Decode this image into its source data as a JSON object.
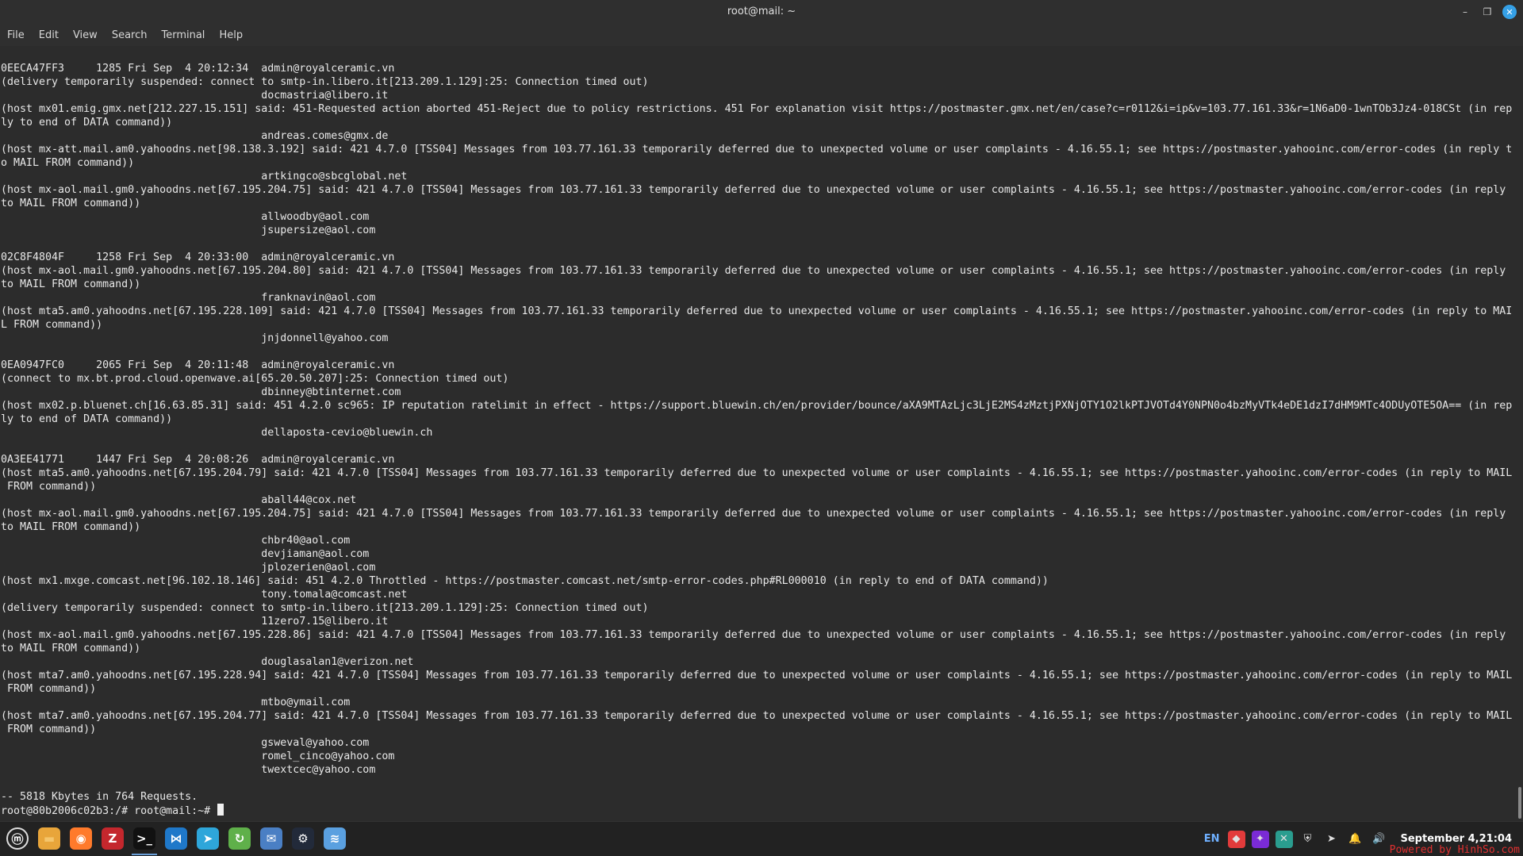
{
  "window": {
    "title": "root@mail: ~",
    "controls": {
      "minimize": "–",
      "maximize": "❐",
      "close": "✕"
    }
  },
  "menu": {
    "items": [
      "File",
      "Edit",
      "View",
      "Search",
      "Terminal",
      "Help"
    ]
  },
  "terminal": {
    "lines": [
      "0EECA47FF3     1285 Fri Sep  4 20:12:34  admin@royalceramic.vn",
      "(delivery temporarily suspended: connect to smtp-in.libero.it[213.209.1.129]:25: Connection timed out)",
      "                                         docmastria@libero.it",
      "(host mx01.emig.gmx.net[212.227.15.151] said: 451-Requested action aborted 451-Reject due to policy restrictions. 451 For explanation visit https://postmaster.gmx.net/en/case?c=r0112&i=ip&v=103.77.161.33&r=1N6aD0-1wnTOb3Jz4-018CSt (in rep",
      "ly to end of DATA command))",
      "                                         andreas.comes@gmx.de",
      "(host mx-att.mail.am0.yahoodns.net[98.138.3.192] said: 421 4.7.0 [TSS04] Messages from 103.77.161.33 temporarily deferred due to unexpected volume or user complaints - 4.16.55.1; see https://postmaster.yahooinc.com/error-codes (in reply t",
      "o MAIL FROM command))",
      "                                         artkingco@sbcglobal.net",
      "(host mx-aol.mail.gm0.yahoodns.net[67.195.204.75] said: 421 4.7.0 [TSS04] Messages from 103.77.161.33 temporarily deferred due to unexpected volume or user complaints - 4.16.55.1; see https://postmaster.yahooinc.com/error-codes (in reply",
      "to MAIL FROM command))",
      "                                         allwoodby@aol.com",
      "                                         jsupersize@aol.com",
      "",
      "02C8F4804F     1258 Fri Sep  4 20:33:00  admin@royalceramic.vn",
      "(host mx-aol.mail.gm0.yahoodns.net[67.195.204.80] said: 421 4.7.0 [TSS04] Messages from 103.77.161.33 temporarily deferred due to unexpected volume or user complaints - 4.16.55.1; see https://postmaster.yahooinc.com/error-codes (in reply",
      "to MAIL FROM command))",
      "                                         franknavin@aol.com",
      "(host mta5.am0.yahoodns.net[67.195.228.109] said: 421 4.7.0 [TSS04] Messages from 103.77.161.33 temporarily deferred due to unexpected volume or user complaints - 4.16.55.1; see https://postmaster.yahooinc.com/error-codes (in reply to MAI",
      "L FROM command))",
      "                                         jnjdonnell@yahoo.com",
      "",
      "0EA0947FC0     2065 Fri Sep  4 20:11:48  admin@royalceramic.vn",
      "(connect to mx.bt.prod.cloud.openwave.ai[65.20.50.207]:25: Connection timed out)",
      "                                         dbinney@btinternet.com",
      "(host mx02.p.bluenet.ch[16.63.85.31] said: 451 4.2.0 sc965: IP reputation ratelimit in effect - https://support.bluewin.ch/en/provider/bounce/aXA9MTAzLjc3LjE2MS4zMztjPXNjOTY1O2lkPTJVOTd4Y0NPN0o4bzMyVTk4eDE1dzI7dHM9MTc4ODUyOTE5OA== (in rep",
      "ly to end of DATA command))",
      "                                         dellaposta-cevio@bluewin.ch",
      "",
      "0A3EE41771     1447 Fri Sep  4 20:08:26  admin@royalceramic.vn",
      "(host mta5.am0.yahoodns.net[67.195.204.79] said: 421 4.7.0 [TSS04] Messages from 103.77.161.33 temporarily deferred due to unexpected volume or user complaints - 4.16.55.1; see https://postmaster.yahooinc.com/error-codes (in reply to MAIL",
      " FROM command))",
      "                                         aball44@cox.net",
      "(host mx-aol.mail.gm0.yahoodns.net[67.195.204.75] said: 421 4.7.0 [TSS04] Messages from 103.77.161.33 temporarily deferred due to unexpected volume or user complaints - 4.16.55.1; see https://postmaster.yahooinc.com/error-codes (in reply",
      "to MAIL FROM command))",
      "                                         chbr40@aol.com",
      "                                         devjiaman@aol.com",
      "                                         jplozerien@aol.com",
      "(host mx1.mxge.comcast.net[96.102.18.146] said: 451 4.2.0 Throttled - https://postmaster.comcast.net/smtp-error-codes.php#RL000010 (in reply to end of DATA command))",
      "                                         tony.tomala@comcast.net",
      "(delivery temporarily suspended: connect to smtp-in.libero.it[213.209.1.129]:25: Connection timed out)",
      "                                         11zero7.15@libero.it",
      "(host mx-aol.mail.gm0.yahoodns.net[67.195.228.86] said: 421 4.7.0 [TSS04] Messages from 103.77.161.33 temporarily deferred due to unexpected volume or user complaints - 4.16.55.1; see https://postmaster.yahooinc.com/error-codes (in reply",
      "to MAIL FROM command))",
      "                                         douglasalan1@verizon.net",
      "(host mta7.am0.yahoodns.net[67.195.228.94] said: 421 4.7.0 [TSS04] Messages from 103.77.161.33 temporarily deferred due to unexpected volume or user complaints - 4.16.55.1; see https://postmaster.yahooinc.com/error-codes (in reply to MAIL",
      " FROM command))",
      "                                         mtbo@ymail.com",
      "(host mta7.am0.yahoodns.net[67.195.204.77] said: 421 4.7.0 [TSS04] Messages from 103.77.161.33 temporarily deferred due to unexpected volume or user complaints - 4.16.55.1; see https://postmaster.yahooinc.com/error-codes (in reply to MAIL",
      " FROM command))",
      "                                         gsweval@yahoo.com",
      "                                         romel_cinco@yahoo.com",
      "                                         twextcec@yahoo.com",
      "",
      "-- 5818 Kbytes in 764 Requests."
    ],
    "prompt": "root@80b2006c02b3:/# root@mail:~# "
  },
  "taskbar": {
    "apps": [
      {
        "name": "menu",
        "glyph": "ⓜ",
        "bg": "transparent",
        "fg": "#ffffff"
      },
      {
        "name": "files",
        "glyph": "▬",
        "bg": "#e8a53a",
        "fg": "#f5c56b"
      },
      {
        "name": "firefox",
        "glyph": "◉",
        "bg": "#ff7a2b",
        "fg": "#ffffff"
      },
      {
        "name": "filezilla",
        "glyph": "Z",
        "bg": "#c4272d",
        "fg": "#ffffff"
      },
      {
        "name": "terminal",
        "glyph": ">_",
        "bg": "#111111",
        "fg": "#ffffff"
      },
      {
        "name": "vscode",
        "glyph": "⋈",
        "bg": "#1f78c9",
        "fg": "#ffffff"
      },
      {
        "name": "telegram",
        "glyph": "➤",
        "bg": "#2ea6da",
        "fg": "#ffffff"
      },
      {
        "name": "updater",
        "glyph": "↻",
        "bg": "#5fb04a",
        "fg": "#ffffff"
      },
      {
        "name": "mail",
        "glyph": "✉",
        "bg": "#4a7fc4",
        "fg": "#ffffff"
      },
      {
        "name": "chatgpt",
        "glyph": "⚙",
        "bg": "#222a3a",
        "fg": "#ffffff"
      },
      {
        "name": "rss",
        "glyph": "≋",
        "bg": "#5aa0e0",
        "fg": "#ffffff"
      }
    ],
    "active_index": 4,
    "tray": {
      "lang": "EN",
      "icons": [
        {
          "name": "anydesk",
          "glyph": "◆",
          "bg": "#e23b3b"
        },
        {
          "name": "flameshot",
          "glyph": "✦",
          "bg": "#7a2bd6"
        },
        {
          "name": "xapp",
          "glyph": "✕",
          "bg": "#2a9d8f"
        },
        {
          "name": "shield",
          "glyph": "⛨",
          "bg": "transparent"
        },
        {
          "name": "telegram",
          "glyph": "➤",
          "bg": "transparent"
        },
        {
          "name": "notifications",
          "glyph": "🔔",
          "bg": "transparent"
        },
        {
          "name": "volume",
          "glyph": "🔊",
          "bg": "transparent"
        }
      ],
      "clock": "September  4,21:04"
    }
  },
  "watermark": "Powered by HinhSo.com"
}
